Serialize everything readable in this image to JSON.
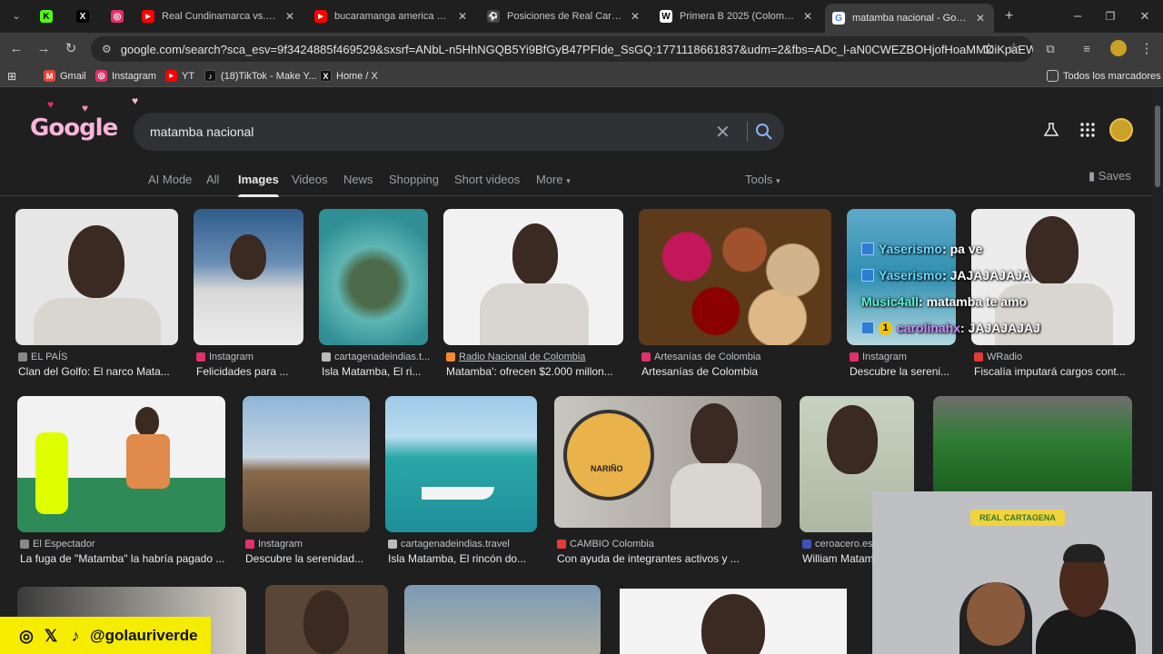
{
  "browser": {
    "tabs": [
      {
        "title": "",
        "icon": "kick-icon",
        "color": "#53fc18",
        "glyph": "K"
      },
      {
        "title": "",
        "icon": "x-icon",
        "color": "#000000",
        "glyph": "X"
      },
      {
        "title": "",
        "icon": "instagram-icon",
        "color": "#e1306c",
        "glyph": "◎"
      },
      {
        "title": "Real Cundinamarca vs. Real C",
        "icon": "youtube-icon",
        "color": "#ff0000",
        "glyph": "▶"
      },
      {
        "title": "bucaramanga america de cali",
        "icon": "youtube-icon",
        "color": "#ff0000",
        "glyph": "▶"
      },
      {
        "title": "Posiciones de Real Cartagena",
        "icon": "site-icon",
        "color": "#444444",
        "glyph": "⚽"
      },
      {
        "title": "Primera B 2025 (Colombia) - W",
        "icon": "wikipedia-icon",
        "color": "#ffffff",
        "glyph": "W"
      },
      {
        "title": "matamba nacional - Google S",
        "icon": "google-icon",
        "color": "#4285f4",
        "glyph": "G"
      }
    ],
    "new_tab": "+",
    "url": "google.com/search?sca_esv=9f3424885f469529&sxsrf=ANbL-n5HhNGQB5Yi9BfGyB47PFIde_SsGQ:1771118661837&udm=2&fbs=ADc_l-aN0CWEZBOHjofHoaMMDiKpaEWjvZ2Py1X..."
  },
  "bookmarks": [
    {
      "label": "Gmail",
      "icon": "gmail-icon",
      "color": "#ea4335"
    },
    {
      "label": "Instagram",
      "icon": "instagram-icon",
      "color": "#e1306c"
    },
    {
      "label": "YT",
      "icon": "youtube-icon",
      "color": "#ff0000"
    },
    {
      "label": "(18)TikTok - Make Y...",
      "icon": "tiktok-icon",
      "color": "#111111"
    },
    {
      "label": "Home / X",
      "icon": "x-icon",
      "color": "#111111"
    }
  ],
  "bookmarks_all": "Todos los marcadores",
  "google": {
    "logo": "Google",
    "query": "matamba nacional",
    "tabs": [
      "AI Mode",
      "All",
      "Images",
      "Videos",
      "News",
      "Shopping",
      "Short videos",
      "More"
    ],
    "selected_tab": "Images",
    "tools": "Tools",
    "saves": "Saves"
  },
  "results_row1": [
    {
      "source": "EL PAÍS",
      "caption": "Clan del Golfo: El narco Mata...",
      "src_color": "#888888"
    },
    {
      "source": "Instagram",
      "caption": "Felicidades para ...",
      "src_color": "#e1306c"
    },
    {
      "source": "cartagenadeindias.t...",
      "caption": "Isla Matamba, El ri...",
      "src_color": "#bbbbbb"
    },
    {
      "source": "Radio Nacional de Colombia",
      "caption": "Matamba': ofrecen $2.000 millon...",
      "src_color": "#f28b30"
    },
    {
      "source": "Artesanías de Colombia",
      "caption": "Artesanías de Colombia",
      "src_color": "#e1306c"
    },
    {
      "source": "Instagram",
      "caption": "Descubre la sereni...",
      "src_color": "#e1306c"
    },
    {
      "source": "WRadio",
      "caption": "Fiscalía imputará cargos cont...",
      "src_color": "#e53935"
    }
  ],
  "results_row2": [
    {
      "source": "El Espectador",
      "caption": "La fuga de \"Matamba\" la habría pagado ...",
      "src_color": "#888888"
    },
    {
      "source": "Instagram",
      "caption": "Descubre la serenidad...",
      "src_color": "#e1306c"
    },
    {
      "source": "cartagenadeindias.travel",
      "caption": "Isla Matamba, El rincón do...",
      "src_color": "#bbbbbb"
    },
    {
      "source": "CAMBIO Colombia",
      "caption": "Con ayuda de integrantes activos y ...",
      "src_color": "#e53935"
    },
    {
      "source": "ceroacero.es",
      "caption": "William Matam",
      "src_color": "#3f51b5"
    },
    {
      "source": "",
      "caption": "",
      "src_color": "#888888"
    }
  ],
  "map_label": "NARIÑO",
  "chat": [
    {
      "user": "Yaserismo",
      "msg": ": pa ve"
    },
    {
      "user": "Yaserismo",
      "msg": ": JAJAJAJAJA"
    },
    {
      "user": "Music4all",
      "msg": ": matamba te amo"
    },
    {
      "user": "carolinahx",
      "msg": ": JAJAJAJAJ"
    }
  ],
  "chat_badge": "1",
  "banner": "REAL CARTAGENA",
  "social": "@golauriverde"
}
